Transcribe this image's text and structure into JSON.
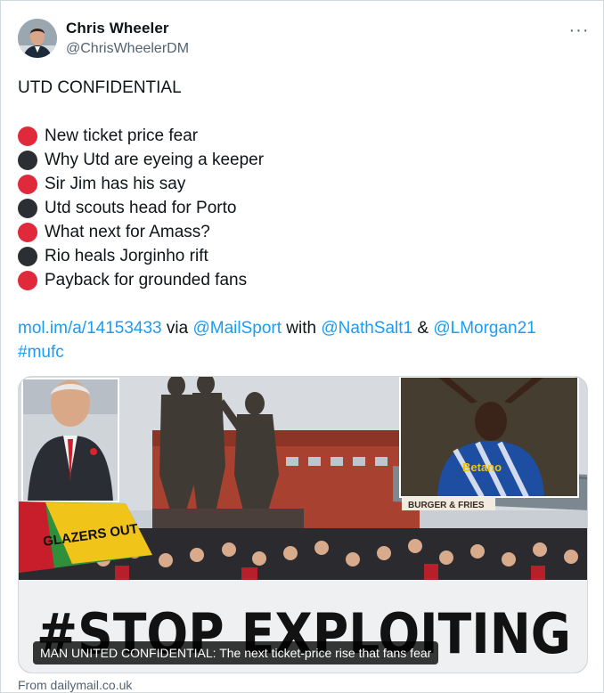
{
  "author": {
    "name": "Chris Wheeler",
    "handle": "@ChrisWheelerDM"
  },
  "more_icon": "more-horizontal-icon",
  "tweet": {
    "headline": "UTD CONFIDENTIAL",
    "bullets": [
      {
        "color": "red",
        "text": "New ticket price fear"
      },
      {
        "color": "black",
        "text": "Why Utd are eyeing a keeper"
      },
      {
        "color": "red",
        "text": "Sir Jim has his say"
      },
      {
        "color": "black",
        "text": "Utd scouts head for Porto"
      },
      {
        "color": "red",
        "text": "What next for Amass?"
      },
      {
        "color": "black",
        "text": "Rio heals Jorginho rift"
      },
      {
        "color": "red",
        "text": "Payback for grounded fans"
      }
    ],
    "link_url": "mol.im/a/14153433",
    "via_text": " via ",
    "mention_1": "@MailSport",
    "with_text": " with ",
    "mention_2": "@NathSalt1",
    "and_text": " & ",
    "mention_3": "@LMorgan21",
    "hashtag": "#mufc"
  },
  "card": {
    "banner_text": "#STOP EXPLOITING",
    "flag_text": "GLAZERS OUT",
    "sign_text": "BURGER & FRIES",
    "shirt_text": "Betano",
    "caption": "MAN UNITED CONFIDENTIAL: The next ticket-price rise that fans fear",
    "source": "From dailymail.co.uk"
  },
  "colors": {
    "link": "#1d9bf0",
    "bullet_red": "#e0293b",
    "bullet_black": "#2b2f33",
    "secondary_text": "#536471"
  }
}
